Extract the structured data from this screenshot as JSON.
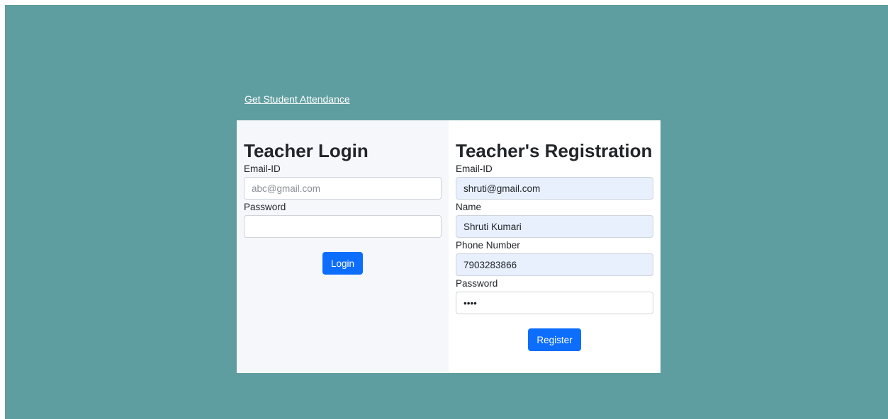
{
  "nav": {
    "attendance_link": "Get Student Attendance"
  },
  "login": {
    "title": "Teacher Login",
    "email_label": "Email-ID",
    "email_placeholder": "abc@gmail.com",
    "email_value": "",
    "password_label": "Password",
    "password_value": "",
    "button_label": "Login"
  },
  "registration": {
    "title": "Teacher's Registration",
    "email_label": "Email-ID",
    "email_value": "shruti@gmail.com",
    "name_label": "Name",
    "name_value": "Shruti Kumari",
    "phone_label": "Phone Number",
    "phone_value": "7903283866",
    "password_label": "Password",
    "password_value": "abcd",
    "button_label": "Register"
  },
  "colors": {
    "background": "#5f9ea0",
    "primary": "#0d6efd",
    "autofill": "#e8f0fe"
  }
}
